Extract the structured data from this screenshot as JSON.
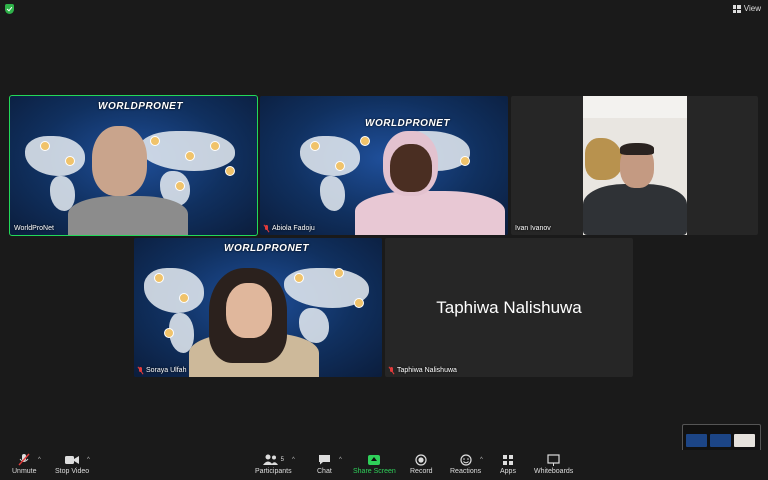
{
  "top": {
    "view_label": "View"
  },
  "participants": [
    {
      "name": "WorldProNet",
      "muted": false
    },
    {
      "name": "Abiola Fadoju",
      "muted": true
    },
    {
      "name": "Ivan Ivanov",
      "muted": false
    },
    {
      "name": "Soraya Ulfah",
      "muted": true
    },
    {
      "name": "Taphiwa Nalishuwa",
      "muted": true
    }
  ],
  "backgrounds": {
    "brand_text": "WORLDPRONET"
  },
  "camera_off_name": "Taphiwa Nalishuwa",
  "toolbar": {
    "unmute": "Unmute",
    "stop_video": "Stop Video",
    "participants": "Participants",
    "participants_count": "5",
    "chat": "Chat",
    "share_screen": "Share Screen",
    "record": "Record",
    "reactions": "Reactions",
    "apps": "Apps",
    "whiteboards": "Whiteboards"
  },
  "colors": {
    "active_speaker": "#23d959",
    "share": "#2fd05a",
    "muted": "#e23b3b"
  }
}
